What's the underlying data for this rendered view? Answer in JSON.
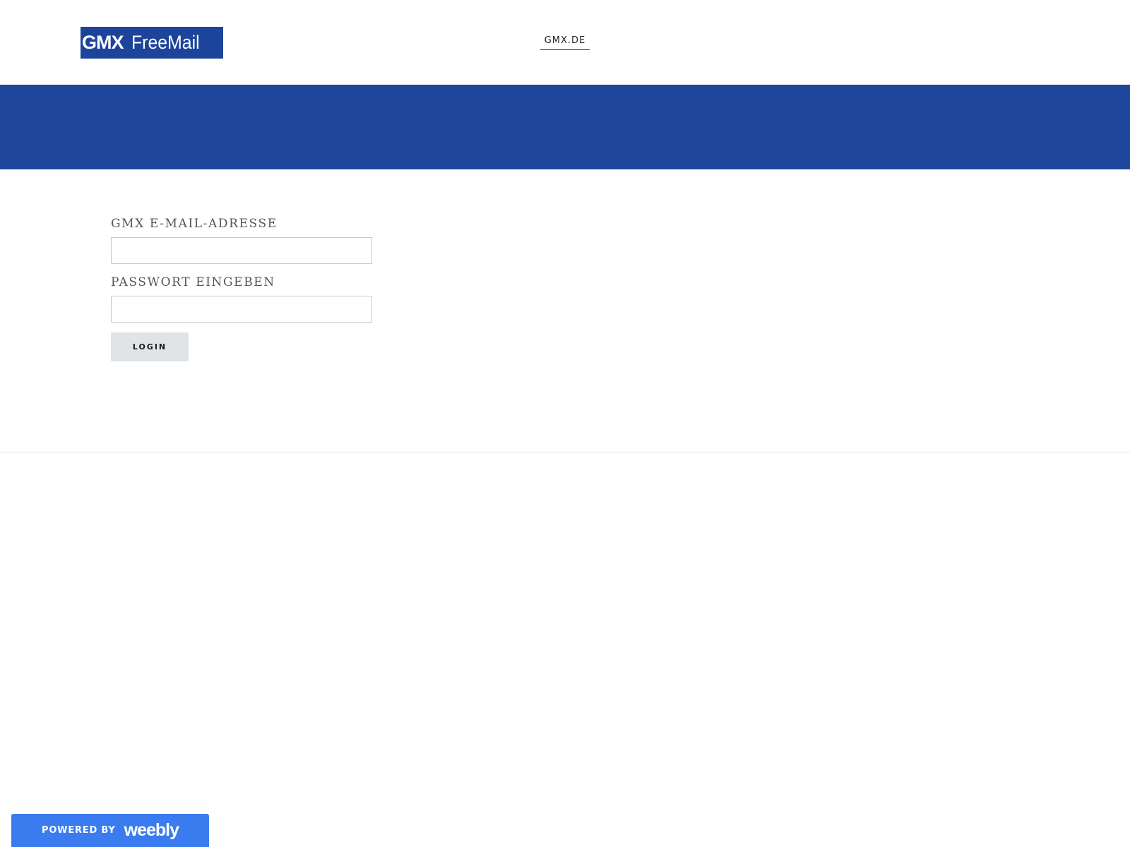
{
  "header": {
    "logo": {
      "brand": "GMX",
      "product": "FreeMail",
      "background_color": "#1c449b"
    },
    "nav": {
      "link_label": "GMX.DE"
    }
  },
  "banner": {
    "background_color": "#1e479c"
  },
  "login_form": {
    "email_label": "GMX E-MAIL-ADRESSE",
    "email_value": "",
    "password_label": "PASSWORT EINGEBEN",
    "password_value": "",
    "submit_label": "LOGIN"
  },
  "footer_badge": {
    "prefix": "POWERED BY",
    "brand": "weebly",
    "background_color": "#3a7cf0"
  }
}
